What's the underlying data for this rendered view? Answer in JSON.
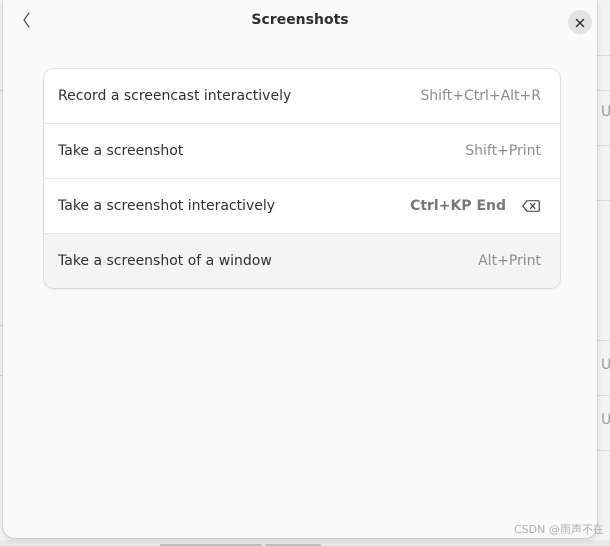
{
  "dialog": {
    "title": "Screenshots",
    "back_icon": "chevron-left-icon",
    "close_icon": "close-icon"
  },
  "shortcuts": [
    {
      "label": "Record a screencast interactively",
      "accelerator": "Shift+Ctrl+Alt+R",
      "edited": false
    },
    {
      "label": "Take a screenshot",
      "accelerator": "Shift+Print",
      "edited": false
    },
    {
      "label": "Take a screenshot interactively",
      "accelerator": "Ctrl+KP End",
      "edited": true,
      "reset_icon": "backspace-icon"
    },
    {
      "label": "Take a screenshot of a window",
      "accelerator": "Alt+Print",
      "edited": false
    }
  ],
  "watermark": "CSDN @雨声不在",
  "colors": {
    "dialog_bg": "#fafafa",
    "card_bg": "#ffffff",
    "selected_row_bg": "#f4f4f4",
    "text": "#303030",
    "accelerator_text": "#8c8c8c"
  }
}
